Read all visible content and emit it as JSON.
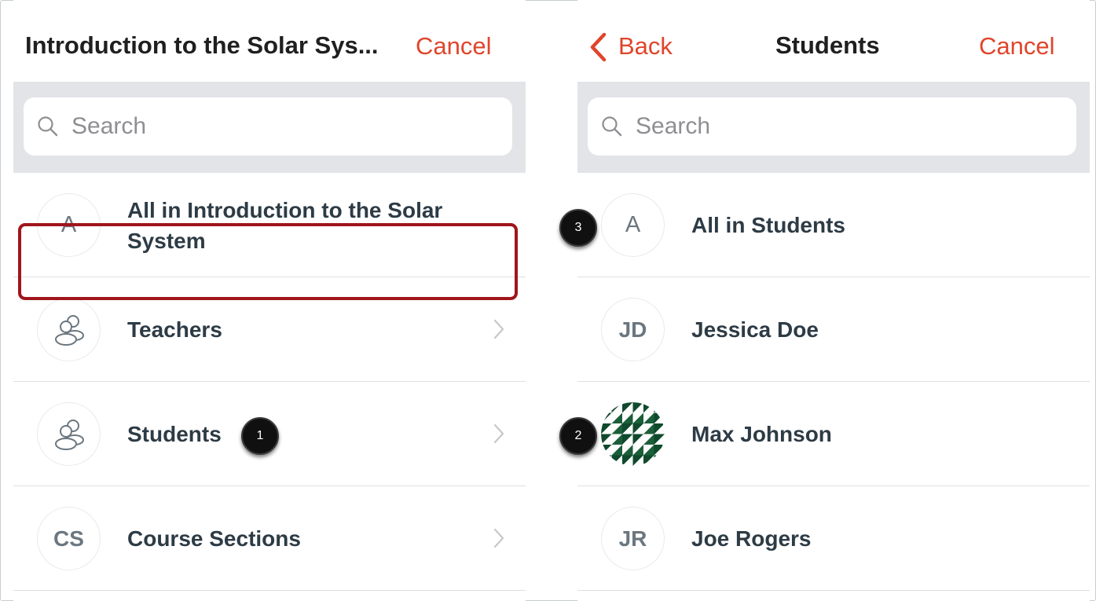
{
  "left_panel": {
    "title": "Introduction to the Solar Sys...",
    "cancel_label": "Cancel",
    "search_placeholder": "Search",
    "rows": [
      {
        "avatar_text": "A",
        "label": "All in Introduction to the Solar System",
        "has_chevron": false
      },
      {
        "avatar_icon": "group-icon",
        "label": "Teachers",
        "has_chevron": true
      },
      {
        "avatar_icon": "group-icon",
        "label": "Students",
        "has_chevron": true
      },
      {
        "avatar_text": "CS",
        "label": "Course Sections",
        "has_chevron": true
      }
    ]
  },
  "right_panel": {
    "back_label": "Back",
    "title": "Students",
    "cancel_label": "Cancel",
    "search_placeholder": "Search",
    "rows": [
      {
        "avatar_text": "A",
        "label": "All in Students"
      },
      {
        "avatar_text": "JD",
        "label": "Jessica Doe"
      },
      {
        "avatar_image": "geometric-pattern-avatar",
        "label": "Max Johnson"
      },
      {
        "avatar_text": "JR",
        "label": "Joe Rogers"
      }
    ]
  },
  "callouts": [
    "1",
    "2",
    "3"
  ],
  "colors": {
    "accent": "#e0452b",
    "highlight_border": "#a0151c",
    "search_band": "#e3e4e8",
    "text": "#2d3b45"
  }
}
